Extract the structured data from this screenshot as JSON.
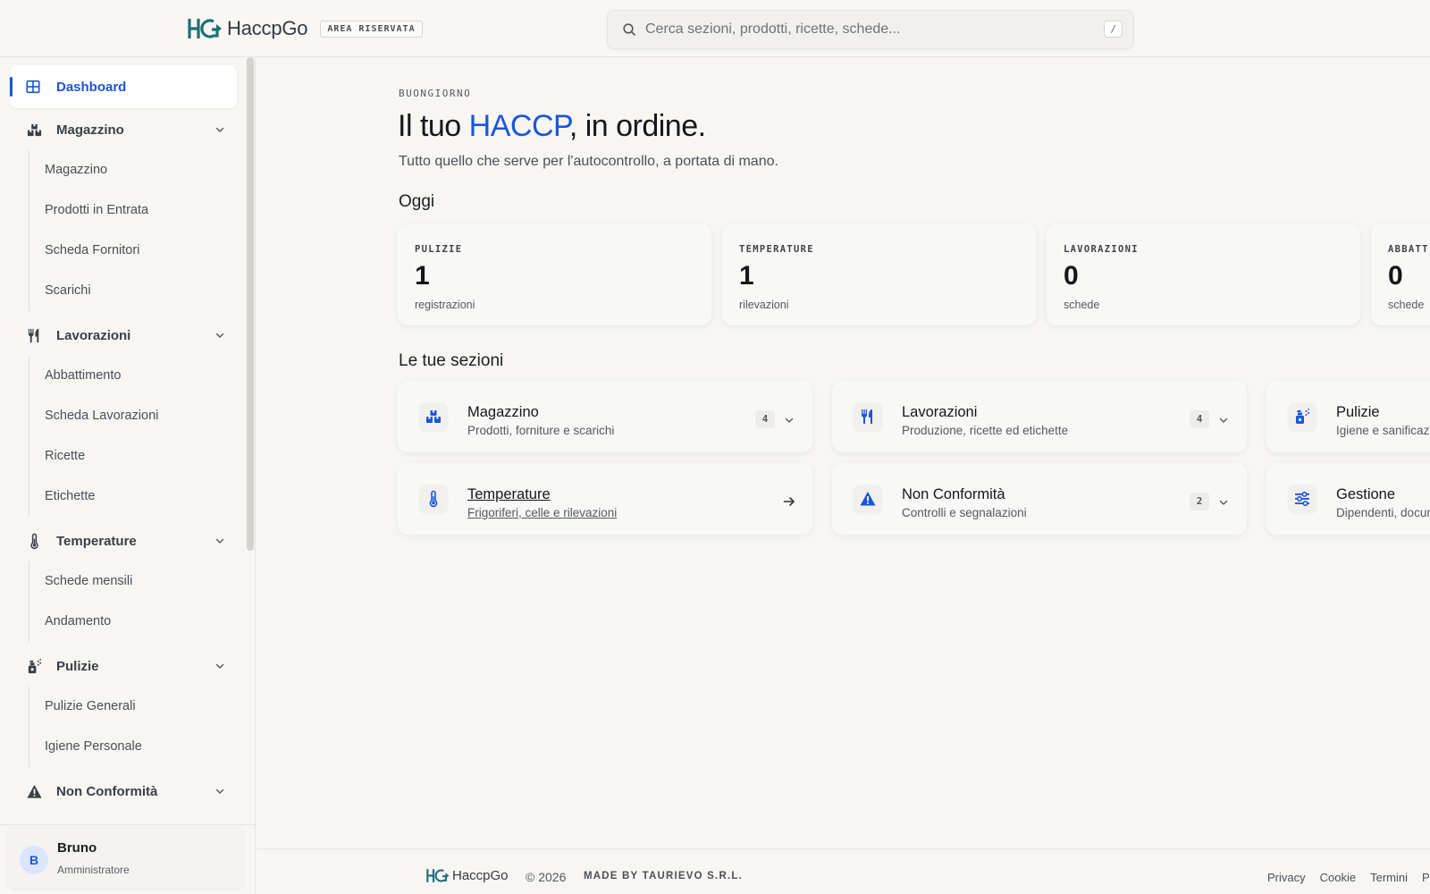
{
  "colors": {
    "accent": "#1a56db",
    "teal": "#1f6f78",
    "background": "#f7f6f3"
  },
  "header": {
    "brand_name": "HaccpGo",
    "area_badge": "AREA RISERVATA",
    "search_placeholder": "Cerca sezioni, prodotti, ricette, schede...",
    "search_shortcut": "/"
  },
  "sidebar": {
    "dashboard": {
      "label": "Dashboard",
      "icon": "grid-icon"
    },
    "groups": [
      {
        "label": "Magazzino",
        "icon": "boxes-icon",
        "items": [
          "Magazzino",
          "Prodotti in Entrata",
          "Scheda Fornitori",
          "Scarichi"
        ]
      },
      {
        "label": "Lavorazioni",
        "icon": "utensils-icon",
        "items": [
          "Abbattimento",
          "Scheda Lavorazioni",
          "Ricette",
          "Etichette"
        ]
      },
      {
        "label": "Temperature",
        "icon": "thermometer-icon",
        "items": [
          "Schede mensili",
          "Andamento"
        ]
      },
      {
        "label": "Pulizie",
        "icon": "spray-icon",
        "items": [
          "Pulizie Generali",
          "Igiene Personale"
        ]
      },
      {
        "label": "Non Conformità",
        "icon": "warning-icon",
        "items": []
      }
    ],
    "user": {
      "initial": "B",
      "name": "Bruno",
      "role": "Amministratore"
    }
  },
  "main": {
    "greeting": "BUONGIORNO",
    "hero_pre": "Il tuo ",
    "hero_accent": "HACCP",
    "hero_post": ", in ordine.",
    "subtitle": "Tutto quello che serve per l'autocontrollo, a portata di mano.",
    "today_heading": "Oggi",
    "stats": [
      {
        "label": "PULIZIE",
        "value": "1",
        "unit": "registrazioni"
      },
      {
        "label": "TEMPERATURE",
        "value": "1",
        "unit": "rilevazioni"
      },
      {
        "label": "LAVORAZIONI",
        "value": "0",
        "unit": "schede"
      },
      {
        "label": "ABBATT",
        "value": "0",
        "unit": "schede"
      }
    ],
    "sections_heading": "Le tue sezioni",
    "sections": [
      {
        "title": "Magazzino",
        "desc": "Prodotti, forniture e scarichi",
        "count": "4",
        "icon": "boxes-icon"
      },
      {
        "title": "Lavorazioni",
        "desc": "Produzione, ricette ed etichette",
        "count": "4",
        "icon": "utensils-icon"
      },
      {
        "title": "Pulizie",
        "desc": "Igiene e sanificazi",
        "icon": "spray-icon"
      },
      {
        "title": "Temperature",
        "desc": "Frigoriferi, celle e rilevazioni",
        "icon": "thermometer-icon"
      },
      {
        "title": "Non Conformità",
        "desc": "Controlli e segnalazioni",
        "count": "2",
        "icon": "warning-icon"
      },
      {
        "title": "Gestione",
        "desc": "Dipendenti, docur",
        "icon": "sliders-icon"
      }
    ]
  },
  "footer": {
    "brand_name": "HaccpGo",
    "copyright": "© 2026",
    "made_by": "MADE BY TAURIEVO S.R.L.",
    "links": [
      "Privacy",
      "Cookie",
      "Termini",
      "P"
    ]
  }
}
